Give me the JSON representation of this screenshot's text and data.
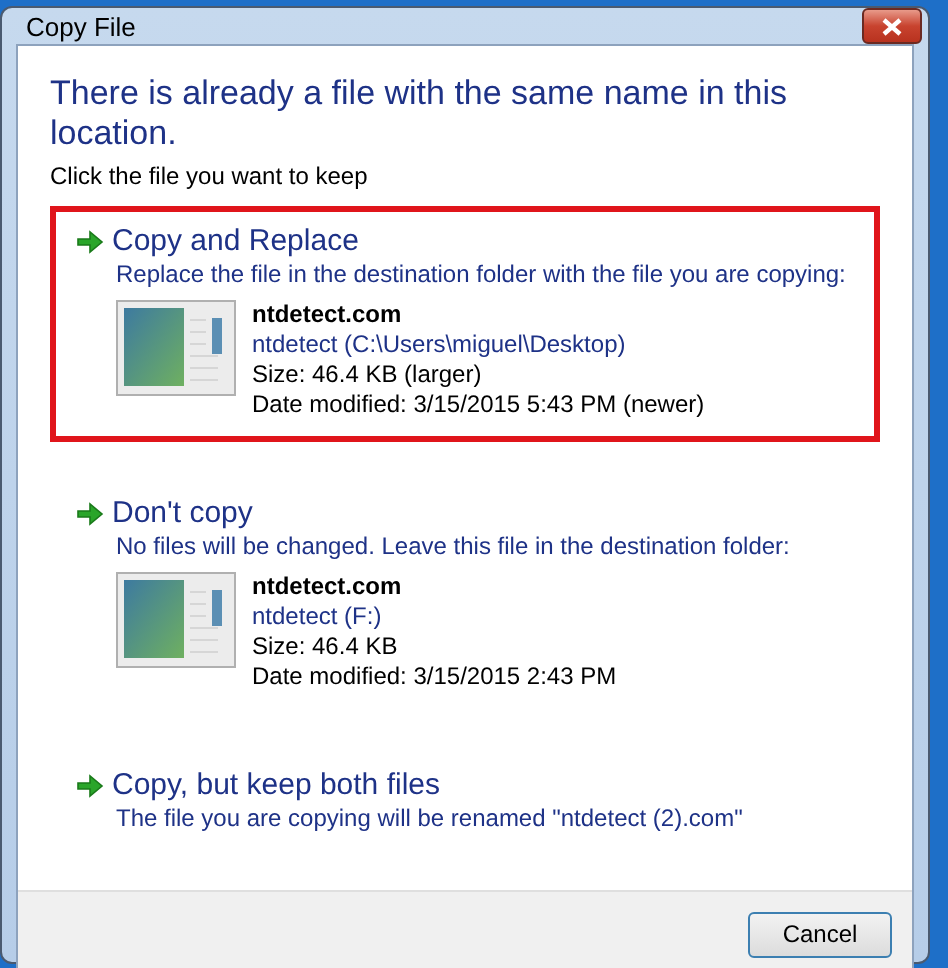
{
  "window": {
    "title": "Copy File"
  },
  "heading": "There is already a file with the same name in this location.",
  "instruction": "Click the file you want to keep",
  "options": [
    {
      "title": "Copy and Replace",
      "description": "Replace the file in the destination folder with the file you are copying:",
      "highlighted": true,
      "file": {
        "name": "ntdetect.com",
        "location": "ntdetect (C:\\Users\\miguel\\Desktop)",
        "size": "Size: 46.4 KB (larger)",
        "modified": "Date modified: 3/15/2015 5:43 PM (newer)"
      }
    },
    {
      "title": "Don't copy",
      "description": "No files will be changed. Leave this file in the destination folder:",
      "highlighted": false,
      "file": {
        "name": "ntdetect.com",
        "location": "ntdetect (F:)",
        "size": "Size: 46.4 KB",
        "modified": "Date modified: 3/15/2015 2:43 PM"
      }
    },
    {
      "title": "Copy, but keep both files",
      "description": "The file you are copying will be renamed \"ntdetect (2).com\"",
      "highlighted": false
    }
  ],
  "buttons": [
    "Cancel"
  ]
}
